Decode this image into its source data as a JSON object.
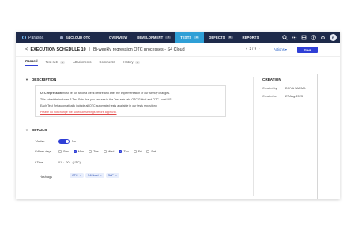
{
  "topnav": {
    "logo_text": "Parasoa",
    "workspace": "S4 CLOUD OTC",
    "items": [
      {
        "label": "OVERVIEW",
        "badge": ""
      },
      {
        "label": "DEVELOPMENT",
        "badge": "0"
      },
      {
        "label": "TESTS",
        "badge": "3"
      },
      {
        "label": "DEFECTS",
        "badge": "0"
      },
      {
        "label": "REPORTS",
        "badge": ""
      }
    ],
    "active_item": "TESTS",
    "avatar_initials": "R",
    "icons": [
      "search-icon",
      "gear-icon",
      "layers-icon",
      "help-icon",
      "bell-icon"
    ]
  },
  "header": {
    "back_glyph": "<",
    "title": "EXECUTION SCHEDULE 10",
    "separator": "|",
    "subtitle": "Bi-weekly regression OTC processes - S4 Cloud",
    "pager": "2 / 9",
    "actions_label": "Actions ▾",
    "save_label": "Save"
  },
  "tabs": [
    {
      "label": "General",
      "count": ""
    },
    {
      "label": "Test sets",
      "count": "3"
    },
    {
      "label": "Attachments",
      "count": ""
    },
    {
      "label": "Comments",
      "count": ""
    },
    {
      "label": "History",
      "count": "0"
    }
  ],
  "description": {
    "heading": "DESCRIPTION",
    "line1_bold": "OTC regression",
    "line1_rest": " must be run twice a week before and after the implementation of our weekly changes.",
    "line2": "This schedule includes 3 Test Sets that you can see in the Test sets tab: OTC Global and OTC Local US",
    "line3": "Each Test Set automatically include all OTC automated tests available in our tests repository.",
    "line4_link": "Please do not change the schedule settings before approval."
  },
  "details": {
    "heading": "DETAILS",
    "active_label": "Active",
    "active_value": "No",
    "weekdays_label": "Week days",
    "weekdays": [
      {
        "label": "Sun",
        "checked": false
      },
      {
        "label": "Mon",
        "checked": true
      },
      {
        "label": "Tue",
        "checked": false
      },
      {
        "label": "Wed",
        "checked": false
      },
      {
        "label": "Thu",
        "checked": true
      },
      {
        "label": "Fri",
        "checked": false
      },
      {
        "label": "Sat",
        "checked": false
      }
    ],
    "time_label": "Time",
    "time_hour": "01",
    "time_minute": "00",
    "time_zone": "(UTC)",
    "hashtags_label": "Hashtags",
    "hashtags": [
      "OTC",
      "S4Cloud",
      "SAP"
    ]
  },
  "creation": {
    "heading": "CREATION",
    "created_by_label": "Created by",
    "created_by_value": "DIVYA SARMA",
    "created_on_label": "Created on",
    "created_on_value": "27-Aug-2023"
  },
  "colors": {
    "nav_bg": "#1e2a4a",
    "active_tab": "#2f9fd6",
    "primary": "#2f3fd6",
    "link_warning": "#e04848"
  }
}
